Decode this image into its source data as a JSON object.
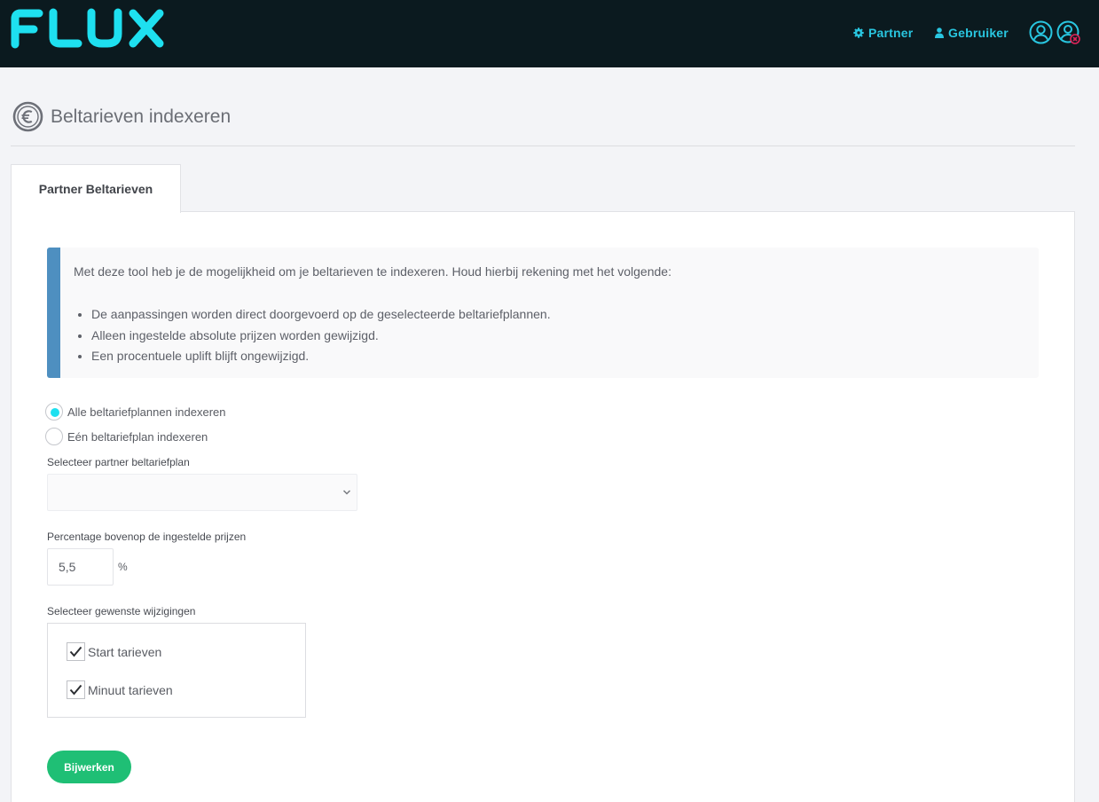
{
  "app": {
    "logo_text": "FLUX",
    "brand_color": "#1ee0f0"
  },
  "topbar": {
    "partner_label": "Partner",
    "partner_icon": "gear-icon",
    "user_label": "Gebruiker",
    "user_icon": "user-icon",
    "avatar_icon": "user-circle-icon",
    "impersonate_icon": "user-circle-close-icon"
  },
  "page": {
    "title": "Beltarieven indexeren",
    "title_icon": "euro-icon"
  },
  "tabs": [
    {
      "label": "Partner Beltarieven",
      "active": true
    }
  ],
  "info": {
    "intro": "Met deze tool heb je de mogelijkheid om je beltarieven te indexeren. Houd hierbij rekening met het volgende:",
    "items": [
      "De aanpassingen worden direct doorgevoerd op de geselecteerde beltariefplannen.",
      "Alleen ingestelde absolute prijzen worden gewijzigd.",
      "Een procentuele uplift blijft ongewijzigd."
    ],
    "accent_color": "#4e8fc0"
  },
  "form": {
    "radio_options": [
      {
        "label": "Alle beltariefplannen indexeren",
        "checked": true
      },
      {
        "label": "Eén beltariefplan indexeren",
        "checked": false
      }
    ],
    "plan_select_label": "Selecteer partner beltariefplan",
    "plan_select_value": "",
    "percentage_label": "Percentage bovenop de ingestelde prijzen",
    "percentage_value": "5,5",
    "percentage_unit": "%",
    "changes_label": "Selecteer gewenste wijzigingen",
    "changes": [
      {
        "label": "Start tarieven",
        "checked": true
      },
      {
        "label": "Minuut tarieven",
        "checked": true
      }
    ],
    "submit_label": "Bijwerken",
    "submit_color": "#1fbf75"
  }
}
